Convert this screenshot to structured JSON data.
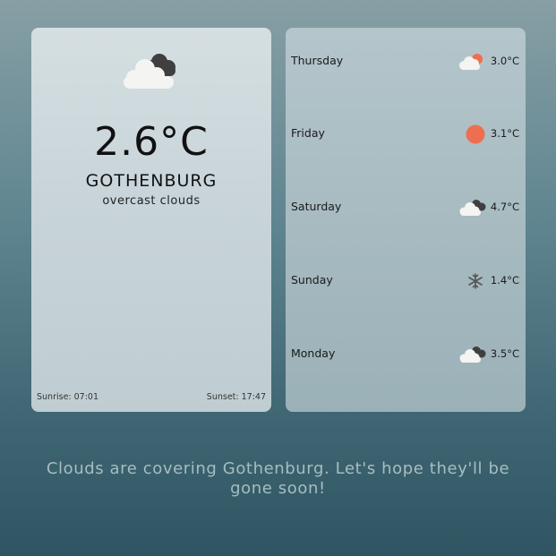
{
  "current": {
    "temperature": "2.6°C",
    "city": "GOTHENBURG",
    "description": "overcast clouds",
    "sunrise": "Sunrise: 07:01",
    "sunset": "Sunset: 17:47",
    "icon": "overcast-cloud-icon"
  },
  "forecast": [
    {
      "day": "Thursday",
      "icon": "partly-cloudy-icon",
      "temp": "3.0°C"
    },
    {
      "day": "Friday",
      "icon": "sun-icon",
      "temp": "3.1°C"
    },
    {
      "day": "Saturday",
      "icon": "cloud-icon",
      "temp": "4.7°C"
    },
    {
      "day": "Sunday",
      "icon": "snow-icon",
      "temp": "1.4°C"
    },
    {
      "day": "Monday",
      "icon": "cloud-icon",
      "temp": "3.5°C"
    }
  ],
  "message": "Clouds are covering Gothenburg. Let's hope they'll be gone soon!",
  "colors": {
    "sun": "#ee6f4f",
    "cloud_dark": "#3f3f3f",
    "cloud_light": "#f4f4f2",
    "message_text": "#a6bdc2"
  }
}
